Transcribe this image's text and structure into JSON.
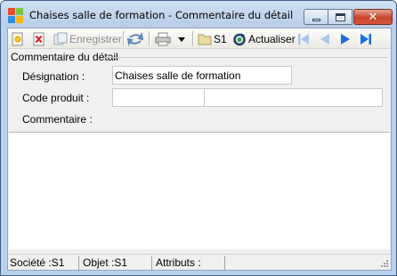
{
  "window": {
    "title": "Chaises salle de formation -  Commentaire du détail"
  },
  "toolbar": {
    "save_label": "Enregistrer",
    "s1_label": "S1",
    "refresh_label": "Actualiser"
  },
  "form": {
    "group_title": "Commentaire du détail",
    "designation_label": "Désignation :",
    "designation_value": "Chaises salle de formation",
    "product_code_label": "Code produit :",
    "product_code_value": "",
    "product_code_desc": "",
    "comment_label": "Commentaire :",
    "comment_value": ""
  },
  "status": {
    "company": "Société :S1",
    "object": "Objet :S1",
    "attributes": "Attributs :"
  },
  "colors": {
    "nav_blue": "#1b6ee0",
    "nav_disabled": "#a9c6ee",
    "delete_red": "#d6252e"
  }
}
